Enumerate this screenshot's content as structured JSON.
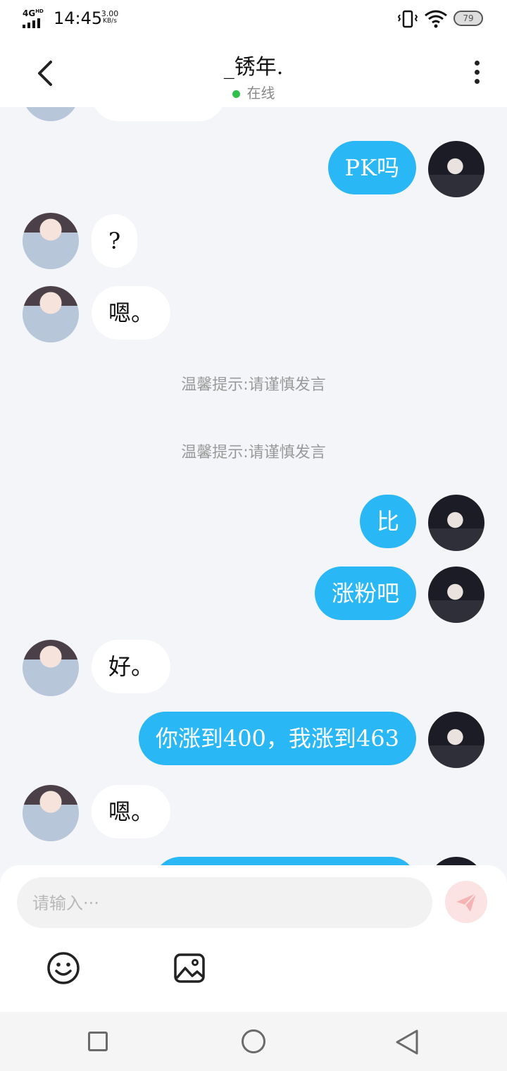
{
  "status_bar": {
    "network": "4G",
    "network_badge": "HD",
    "time": "14:45",
    "speed_value": "3.00",
    "speed_unit": "KB/s",
    "battery": "79",
    "icons": [
      "signal-icon",
      "vibrate-icon",
      "wifi-icon",
      "battery-icon"
    ]
  },
  "header": {
    "title": "_锈年.",
    "status": "在线",
    "status_color": "#2fbf4a",
    "icons": [
      "back-arrow-icon",
      "more-vertical-icon"
    ]
  },
  "messages": [
    {
      "side": "in",
      "text": "",
      "partial": true
    },
    {
      "side": "out",
      "text": "PK吗"
    },
    {
      "side": "in",
      "text": "?"
    },
    {
      "side": "in",
      "text": "嗯。"
    },
    {
      "side": "notice",
      "text": "温馨提示:请谨慎发言"
    },
    {
      "side": "notice",
      "text": "温馨提示:请谨慎发言"
    },
    {
      "side": "out",
      "text": "比"
    },
    {
      "side": "out",
      "text": "涨粉吧"
    },
    {
      "side": "in",
      "text": "好。"
    },
    {
      "side": "out",
      "text": "你涨到400，我涨到463"
    },
    {
      "side": "in",
      "text": "嗯。"
    },
    {
      "side": "out",
      "text": "",
      "partial": true
    }
  ],
  "composer": {
    "placeholder": "请输入···",
    "icons": [
      "send-icon",
      "emoji-icon",
      "image-icon"
    ]
  },
  "nav_bar": {
    "icons": [
      "recent-apps-icon",
      "home-icon",
      "back-triangle-icon"
    ]
  },
  "colors": {
    "accent": "#29b7f5",
    "background": "#f3f5f8",
    "incoming_bubble": "#ffffff",
    "send_button": "#fbe3e3"
  }
}
